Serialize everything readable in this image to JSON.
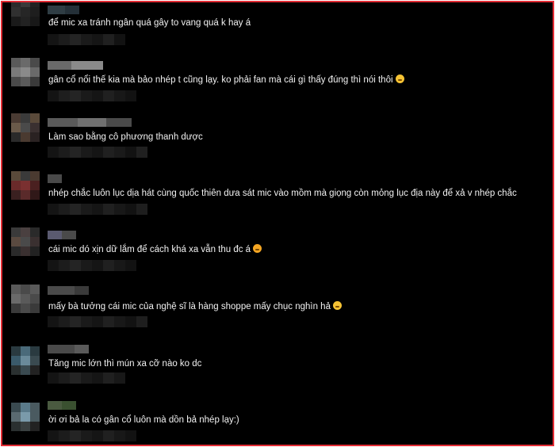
{
  "comments": [
    {
      "text": "để mic xa tránh ngân quá gây to vang quá k hay á",
      "emoji": ""
    },
    {
      "text": "gân cổ nổi thế kia mà bảo nhép t cũng lạy. ko phải fan mà cái gì thấy đúng thì nói thôi",
      "emoji": "rolling-laughing-emoji"
    },
    {
      "text": "Làm sao bằng cô phương thanh dược",
      "emoji": ""
    },
    {
      "text": "nhép chắc luôn lục dịa hát cùng quốc thiên dưa sát mic vào mồm mà giọng còn mỏng lục địa này để xả v nhép chắc",
      "emoji": ""
    },
    {
      "text": "cái mic dó xịn dữ lắm để cách khá xa vẫn thu đc á",
      "emoji": "heart-eyes-emoji"
    },
    {
      "text": "mấy bà tưởng cái mic của nghệ sĩ là hàng shoppe mấy chục nghìn hả",
      "emoji": "grinning-sweat-emoji"
    },
    {
      "text": "Tăng mic lớn thì mún xa cỡ nào ko dc",
      "emoji": ""
    },
    {
      "text": "ời ơi bả la có gân cổ luôn mà dồn bả nhép lạy:)",
      "emoji": ""
    }
  ],
  "colors": {
    "frame_border": "#e22b34",
    "background": "#000000",
    "text": "#f2f2f2"
  }
}
